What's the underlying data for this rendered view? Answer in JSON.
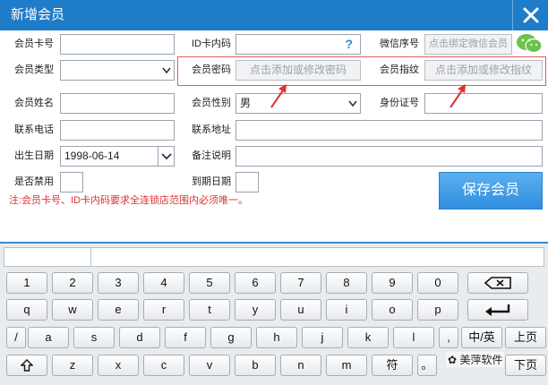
{
  "window": {
    "title": "新增会员"
  },
  "form": {
    "card_no_label": "会员卡号",
    "id_card_label": "ID卡内码",
    "id_card_help": "?",
    "wechat_label": "微信序号",
    "wechat_placeholder": "点击绑定微信会员",
    "type_label": "会员类型",
    "password_label": "会员密码",
    "password_button": "点击添加或修改密码",
    "fingerprint_label": "会员指纹",
    "fingerprint_button": "点击添加或修改指纹",
    "name_label": "会员姓名",
    "gender_label": "会员性别",
    "gender_value": "男",
    "idno_label": "身份证号",
    "phone_label": "联系电话",
    "address_label": "联系地址",
    "birthday_label": "出生日期",
    "birthday_value": "1998-06-14",
    "remark_label": "备注说明",
    "disabled_label": "是否禁用",
    "expiry_label": "到期日期",
    "note": "注:会员卡号、ID卡内码要求全连锁店范围内必须唯一。",
    "save_button": "保存会员"
  },
  "keyboard": {
    "row1": [
      "1",
      "2",
      "3",
      "4",
      "5",
      "6",
      "7",
      "8",
      "9",
      "0"
    ],
    "row2": [
      "q",
      "w",
      "e",
      "r",
      "t",
      "y",
      "u",
      "i",
      "o",
      "p"
    ],
    "row3": [
      "/",
      "a",
      "s",
      "d",
      "f",
      "g",
      "h",
      "j",
      "k",
      "l",
      ","
    ],
    "row3_lang": "中/英",
    "row3_pageup": "上页",
    "row4": [
      "z",
      "x",
      "c",
      "v",
      "b",
      "n",
      "m"
    ],
    "row4_symbol": "符",
    "row4_dot": "。",
    "row4_pagedown": "下页"
  },
  "watermark": "美萍软件",
  "colors": {
    "titlebar": "#1f7cc9",
    "accent": "#2f8ede",
    "note": "#e03030",
    "annotation": "#e45a5a"
  }
}
